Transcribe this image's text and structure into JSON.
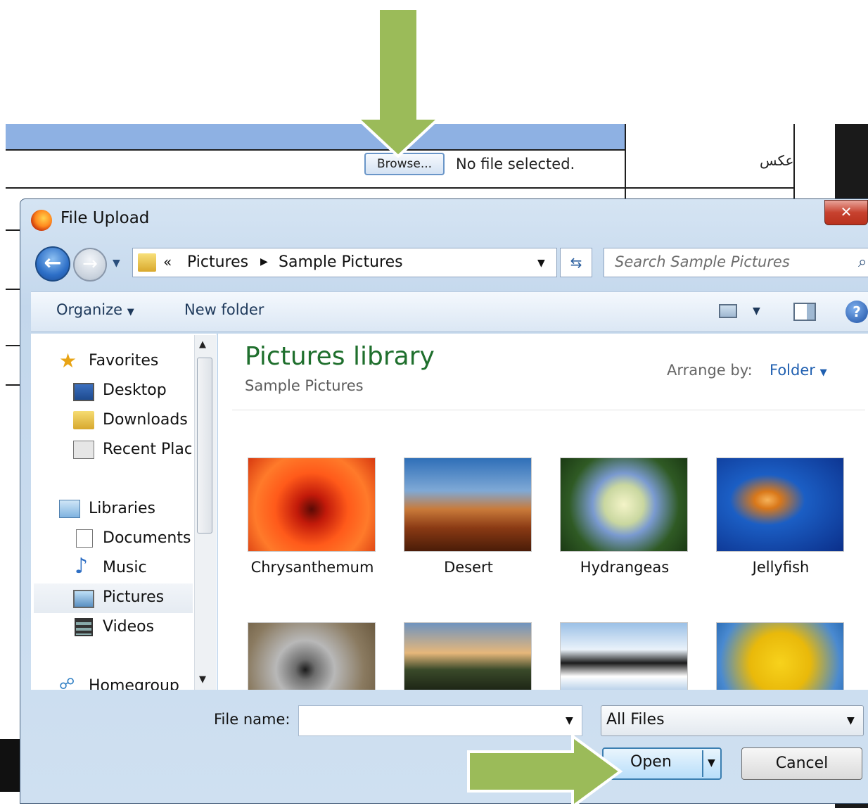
{
  "background_page": {
    "browse_label": "Browse...",
    "no_file_text": "No file selected.",
    "field_label": "عکس"
  },
  "dialog": {
    "title": "File Upload",
    "breadcrumb": {
      "overflow": "«",
      "items": [
        "Pictures",
        "Sample Pictures"
      ]
    },
    "search_placeholder": "Search Sample Pictures",
    "toolbar": {
      "organize": "Organize",
      "new_folder": "New folder"
    },
    "nav": {
      "favorites": {
        "label": "Favorites",
        "items": [
          "Desktop",
          "Downloads",
          "Recent Places"
        ]
      },
      "libraries": {
        "label": "Libraries",
        "items": [
          "Documents",
          "Music",
          "Pictures",
          "Videos"
        ]
      },
      "homegroup": "Homegroup",
      "selected": "Pictures"
    },
    "content": {
      "library_title": "Pictures library",
      "library_subtitle": "Sample Pictures",
      "arrange_label": "Arrange by:",
      "arrange_value": "Folder",
      "files": [
        {
          "name": "Chrysanthemum"
        },
        {
          "name": "Desert"
        },
        {
          "name": "Hydrangeas"
        },
        {
          "name": "Jellyfish"
        },
        {
          "name": ""
        },
        {
          "name": ""
        },
        {
          "name": ""
        },
        {
          "name": ""
        }
      ]
    },
    "footer": {
      "file_name_label": "File name:",
      "file_name_value": "",
      "file_type": "All Files",
      "open_label": "Open",
      "cancel_label": "Cancel"
    }
  },
  "colors": {
    "annotation_arrow": "#9bbb59",
    "library_title": "#1f6f2d",
    "link_blue": "#1f5fb0"
  }
}
